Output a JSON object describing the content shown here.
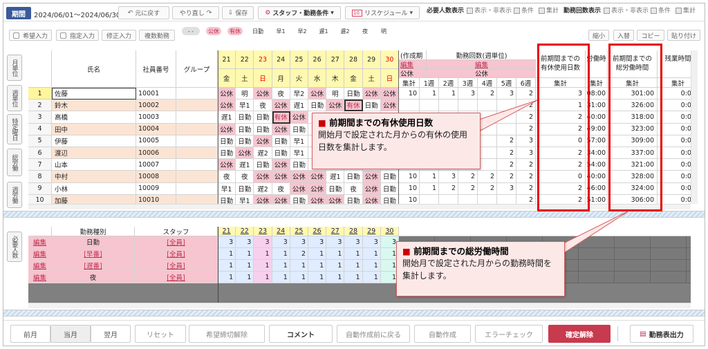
{
  "toolbar": {
    "period_label": "期間",
    "period_value": "2024/06/01～2024/06/30",
    "undo": "元に戻す",
    "redo": "やり直し",
    "save": "保存",
    "staff_cond": "スタッフ・勤務条件",
    "reschedule": "リスケジュール",
    "reqdisp_label": "必要人数表示",
    "show_hide": "表示・非表示",
    "cond": "条件",
    "total": "集計",
    "cntdisp_label": "勤務回数表示"
  },
  "sub": {
    "wish": "希望入力",
    "assign": "指定入力",
    "fix": "修正入力",
    "multi": "複数勤務",
    "shrink": "縮小",
    "insert": "入替",
    "copy": "コピー",
    "paste": "貼り付け",
    "legend": [
      {
        "t": "- -",
        "bg": "#e0e0e0",
        "c": "#444"
      },
      {
        "t": "公休",
        "bg": "#f6c5cf",
        "c": "#c03050"
      },
      {
        "t": "有休",
        "bg": "#f6c5cf",
        "c": "#c03050"
      },
      {
        "t": "日勤",
        "bg": "",
        "c": "#333"
      },
      {
        "t": "早1",
        "bg": "",
        "c": "#333"
      },
      {
        "t": "早2",
        "bg": "",
        "c": "#333"
      },
      {
        "t": "遅1",
        "bg": "",
        "c": "#333"
      },
      {
        "t": "遅2",
        "bg": "",
        "c": "#333"
      },
      {
        "t": "夜",
        "bg": "",
        "c": "#333"
      },
      {
        "t": "明",
        "bg": "",
        "c": "#333"
      }
    ]
  },
  "sidetabs": [
    "月単位",
    "週単位",
    "特定曜日",
    "総労働",
    "週労働"
  ],
  "reqtab": "必要人数",
  "grid": {
    "h_name": "氏名",
    "h_id": "社員番号",
    "h_group": "グループ",
    "days": [
      {
        "d": "21",
        "w": "金"
      },
      {
        "d": "22",
        "w": "土"
      },
      {
        "d": "23",
        "w": "日"
      },
      {
        "d": "24",
        "w": "月"
      },
      {
        "d": "25",
        "w": "火"
      },
      {
        "d": "26",
        "w": "水"
      },
      {
        "d": "27",
        "w": "木"
      },
      {
        "d": "28",
        "w": "金"
      },
      {
        "d": "29",
        "w": "土"
      },
      {
        "d": "30",
        "w": "日"
      }
    ],
    "sum_sec1": "(作成期",
    "sum_sec2": "勤務回数(週単位)",
    "edit": "編集",
    "kokyu": "公休",
    "totals": "集計",
    "weeks": [
      "1週",
      "2週",
      "3週",
      "4週",
      "5週",
      "6週"
    ],
    "h_paid": "前期間までの\n有休使用日数",
    "h_work": "労働時",
    "h_totwork": "前期間までの\n総労働時間",
    "h_ot": "残業時間",
    "rows": [
      {
        "n": "1",
        "name": "佐藤",
        "id": "10001",
        "s": [
          "公休",
          "明",
          "公休",
          "夜",
          "早2",
          "公休",
          "明",
          "日勤",
          "公休",
          "公休"
        ],
        "t": "10",
        "w": [
          "1",
          "1",
          "3",
          "2",
          "3",
          "2"
        ],
        "p": "3",
        "wt": "08:00",
        "tw": "301:00",
        "ot": "0:00"
      },
      {
        "n": "2",
        "name": "鈴木",
        "id": "10002",
        "s": [
          "公休",
          "早1",
          "夜",
          "公休",
          "遅1",
          "日勤",
          "公休",
          "有休",
          "日勤",
          "公休"
        ],
        "t": "",
        "w": [
          "",
          "",
          "",
          "",
          "",
          "2"
        ],
        "p": "1",
        "wt": "31:00",
        "tw": "326:00",
        "ot": "0:00"
      },
      {
        "n": "3",
        "name": "高橋",
        "id": "10003",
        "s": [
          "遅1",
          "日勤",
          "日勤",
          "有休",
          "公休",
          "",
          "",
          "",
          "",
          ""
        ],
        "t": "",
        "w": [
          "",
          "",
          "",
          "",
          "",
          "2"
        ],
        "p": "2",
        "wt": "40:00",
        "tw": "318:00",
        "ot": "0:00"
      },
      {
        "n": "4",
        "name": "田中",
        "id": "10004",
        "s": [
          "公休",
          "日勤",
          "日勤",
          "公休",
          "日勤",
          "",
          "",
          "",
          "",
          ""
        ],
        "t": "",
        "w": [
          "",
          "",
          "",
          "",
          "",
          "2"
        ],
        "p": "2",
        "wt": "49:00",
        "tw": "323:00",
        "ot": "0:00"
      },
      {
        "n": "5",
        "name": "伊藤",
        "id": "10005",
        "s": [
          "日勤",
          "日勤",
          "公休",
          "日勤",
          "早1",
          "",
          "",
          "",
          "",
          ""
        ],
        "t": "",
        "w": [
          "",
          "",
          "",
          "",
          "2",
          "3"
        ],
        "p": "0",
        "wt": "57:00",
        "tw": "309:00",
        "ot": "0:00"
      },
      {
        "n": "6",
        "name": "渡辺",
        "id": "10006",
        "s": [
          "日勤",
          "公休",
          "遅2",
          "日勤",
          "早1",
          "",
          "",
          "",
          "",
          ""
        ],
        "t": "",
        "w": [
          "",
          "",
          "",
          "",
          "2",
          "3"
        ],
        "p": "2",
        "wt": "34:00",
        "tw": "337:00",
        "ot": "0:00"
      },
      {
        "n": "7",
        "name": "山本",
        "id": "10007",
        "s": [
          "公休",
          "遅1",
          "日勤",
          "公休",
          "日勤",
          "",
          "",
          "",
          "",
          ""
        ],
        "t": "",
        "w": [
          "",
          "",
          "",
          "",
          "2",
          "2"
        ],
        "p": "2",
        "wt": "54:00",
        "tw": "321:00",
        "ot": "0:00"
      },
      {
        "n": "8",
        "name": "中村",
        "id": "10008",
        "s": [
          "夜",
          "夜",
          "公休",
          "公休",
          "公休",
          "公休",
          "遅1",
          "日勤",
          "公休",
          "日勤"
        ],
        "t": "10",
        "w": [
          "1",
          "3",
          "2",
          "2",
          "2",
          "2"
        ],
        "p": "0",
        "wt": "40:00",
        "tw": "328:00",
        "ot": "0:00"
      },
      {
        "n": "9",
        "name": "小林",
        "id": "10009",
        "s": [
          "早1",
          "日勤",
          "遅2",
          "夜",
          "公休",
          "公休",
          "日勤",
          "夜",
          "公休",
          "日勤"
        ],
        "t": "10",
        "w": [
          "1",
          "2",
          "2",
          "2",
          "3",
          "2"
        ],
        "p": "2",
        "wt": "46:00",
        "tw": "324:00",
        "ot": "0:00"
      },
      {
        "n": "10",
        "name": "加藤",
        "id": "10010",
        "s": [
          "日勤",
          "早1",
          "公休",
          "公休",
          "日勤",
          "公休",
          "公休",
          "日勤",
          "公休",
          "日勤"
        ],
        "t": "10",
        "w": [
          "",
          "",
          "",
          "",
          "",
          "2"
        ],
        "p": "2",
        "wt": "51:00",
        "tw": "306:00",
        "ot": "0:00"
      }
    ]
  },
  "req": {
    "h_type": "勤務種別",
    "h_staff": "スタッフ",
    "days": [
      "21",
      "22",
      "23",
      "24",
      "25",
      "26",
      "27",
      "28",
      "29",
      "30"
    ],
    "rows": [
      {
        "edit": "編集",
        "type": "日勤",
        "staff": "[全員]",
        "v": [
          "3",
          "3",
          "3",
          "3",
          "3",
          "3",
          "3",
          "3",
          "3",
          "3"
        ]
      },
      {
        "edit": "編集",
        "type": "[早番]",
        "staff": "[全員]",
        "v": [
          "1",
          "1",
          "1",
          "1",
          "2",
          "1",
          "1",
          "1",
          "1",
          "1"
        ]
      },
      {
        "edit": "編集",
        "type": "[遅番]",
        "staff": "[全員]",
        "v": [
          "1",
          "1",
          "1",
          "1",
          "1",
          "1",
          "1",
          "1",
          "1",
          "1"
        ]
      },
      {
        "edit": "編集",
        "type": "夜",
        "staff": "[全員]",
        "v": [
          "1",
          "1",
          "1",
          "1",
          "1",
          "1",
          "1",
          "1",
          "1",
          "1"
        ]
      }
    ]
  },
  "callouts": {
    "c1_title": "前期間までの有休使用日数",
    "c1_body": "開始月で設定された月からの有休の使用日数を集計します。",
    "c2_title": "前期間までの総労働時間",
    "c2_body": "開始月で設定された月からの勤務時間を集計します。",
    "bullet": "■"
  },
  "bottom": {
    "prev": "前月",
    "cur": "当月",
    "next": "翌月",
    "reset": "リセット",
    "wish_release": "希望締切解除",
    "comment": "コメント",
    "back": "自動作成前に戻る",
    "auto": "自動作成",
    "error": "エラーチェック",
    "confirm_release": "確定解除",
    "export": "勤務表出力"
  },
  "colors": {
    "accent": "#3a5a9a",
    "pink": "#f6c5cf",
    "salmon": "#fbe4d4",
    "highlight": "#fff59d",
    "confirm": "#c83a4e"
  }
}
